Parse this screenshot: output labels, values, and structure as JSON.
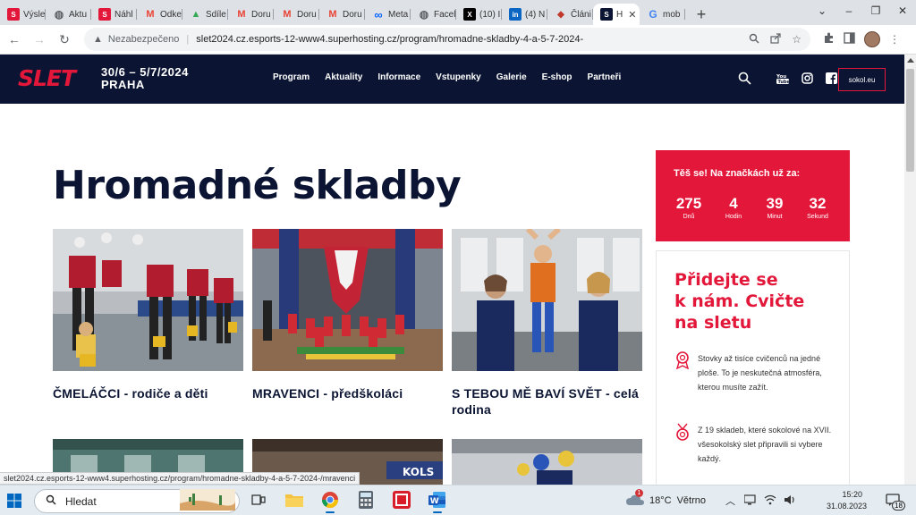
{
  "browser": {
    "tabs": [
      {
        "label": "Výsle",
        "favicon_color": "#e3173a",
        "favicon_glyph": "S"
      },
      {
        "label": "Aktu",
        "favicon_color": "#5f6368",
        "favicon_glyph": "globe-icon"
      },
      {
        "label": "Náhl",
        "favicon_color": "#e3173a",
        "favicon_glyph": "S"
      },
      {
        "label": "Odke",
        "favicon_color": "#ea4335",
        "favicon_glyph": "M"
      },
      {
        "label": "Sdíle",
        "favicon_color": "#34a853",
        "favicon_glyph": "drive-icon"
      },
      {
        "label": "Doru",
        "favicon_color": "#ea4335",
        "favicon_glyph": "M"
      },
      {
        "label": "Doru",
        "favicon_color": "#ea4335",
        "favicon_glyph": "M"
      },
      {
        "label": "Doru",
        "favicon_color": "#ea4335",
        "favicon_glyph": "M"
      },
      {
        "label": "Meta",
        "favicon_color": "#0866ff",
        "favicon_glyph": "∞"
      },
      {
        "label": "Facel",
        "favicon_color": "#5f6368",
        "favicon_glyph": "globe-icon"
      },
      {
        "label": "(10) I",
        "favicon_color": "#000000",
        "favicon_glyph": "X"
      },
      {
        "label": "(4) N",
        "favicon_color": "#0a66c2",
        "favicon_glyph": "in"
      },
      {
        "label": "Článi",
        "favicon_color": "#c0392b",
        "favicon_glyph": "◆"
      },
      {
        "label": "H",
        "favicon_color": "#0b1533",
        "favicon_glyph": "S",
        "active": true
      },
      {
        "label": "mob",
        "favicon_color": "#4285f4",
        "favicon_glyph": "G"
      }
    ],
    "new_tab": "+",
    "window_controls": [
      "⌄",
      "–",
      "❐",
      "✕"
    ],
    "address": {
      "security_label": "Nezabezpečeno",
      "url": "slet2024.cz.esports-12-www4.superhosting.cz/program/hromadne-skladby-4-a-5-7-2024-"
    },
    "status_url": "slet2024.cz.esports-12-www4.superhosting.cz/program/hromadne-skladby-4-a-5-7-2024-/mravenci"
  },
  "site": {
    "logo_text": "SLET",
    "dates_line": "30/6 – 5/7/2024",
    "city": "PRAHA",
    "nav": [
      "Program",
      "Aktuality",
      "Informace",
      "Vstupenky",
      "Galerie",
      "E-shop",
      "Partneři"
    ],
    "sokol_button": "sokol.eu",
    "page_title": "Hromadné skladby",
    "cards": [
      {
        "title": "ČMELÁČCI - rodiče a děti"
      },
      {
        "title": "MRAVENCI - předškoláci"
      },
      {
        "title": "S TEBOU MĚ BAVÍ SVĚT - celá rodina"
      }
    ],
    "countdown": {
      "title": "Těš se! Na značkách už za:",
      "items": [
        {
          "value": "275",
          "label": "Dnů"
        },
        {
          "value": "4",
          "label": "Hodin"
        },
        {
          "value": "39",
          "label": "Minut"
        },
        {
          "value": "32",
          "label": "Sekund"
        }
      ]
    },
    "join": {
      "heading_lines": [
        "Přidejte se",
        "k nám. Cvičte",
        "na sletu"
      ],
      "items": [
        {
          "text": "Stovky až tisíce cvičenců na jedné ploše. To je neskutečná atmosféra, kterou musíte zažít."
        },
        {
          "text": "Z 19 skladeb, které sokolové na XVII. všesokolský slet připravili si vybere každý."
        }
      ]
    },
    "colors": {
      "navy": "#0b1533",
      "red": "#e3173a"
    }
  },
  "taskbar": {
    "search_label": "Hledat",
    "weather_temp": "18°C",
    "weather_text": "Větrno",
    "time": "15:20",
    "date": "31.08.2023",
    "notification_count": "18"
  }
}
